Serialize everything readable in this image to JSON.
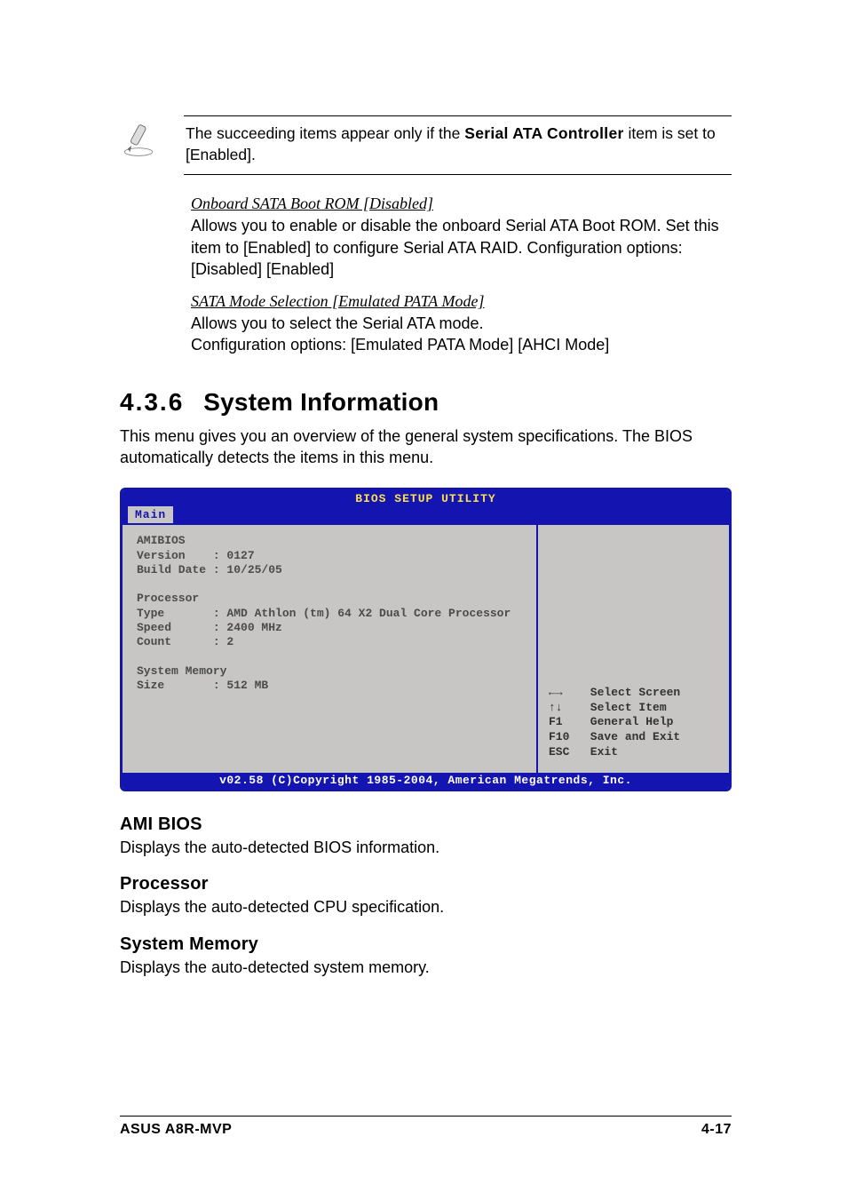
{
  "note": {
    "prefix": "The succeeding items appear only if the ",
    "bold": "Serial ATA Controller",
    "suffix": " item is set to [Enabled]."
  },
  "item1": {
    "title": "Onboard SATA Boot ROM [Disabled]",
    "body": "Allows you to enable or disable the onboard Serial ATA Boot ROM. Set this item to [Enabled] to configure Serial ATA RAID. Configuration options: [Disabled] [Enabled]"
  },
  "item2": {
    "title": "SATA Mode Selection [Emulated PATA Mode]",
    "body": "Allows you to select the Serial ATA mode.\nConfiguration options: [Emulated PATA Mode] [AHCI Mode]"
  },
  "section": {
    "num": "4.3.6",
    "title": "System Information",
    "intro": "This menu gives you an overview of the general system specifications. The BIOS automatically detects the items in this menu."
  },
  "bios": {
    "title": "BIOS SETUP UTILITY",
    "tab": "Main",
    "left": "AMIBIOS\nVersion    : 0127\nBuild Date : 10/25/05\n\nProcessor\nType       : AMD Athlon (tm) 64 X2 Dual Core Processor\nSpeed      : 2400 MHz\nCount      : 2\n\nSystem Memory\nSize       : 512 MB",
    "help": "←→    Select Screen\n↑↓    Select Item\nF1    General Help\nF10   Save and Exit\nESC   Exit",
    "footer": "v02.58 (C)Copyright 1985-2004, American Megatrends, Inc."
  },
  "sub1": {
    "title": "AMI BIOS",
    "body": "Displays the auto-detected BIOS information."
  },
  "sub2": {
    "title": "Processor",
    "body": "Displays the auto-detected CPU specification."
  },
  "sub3": {
    "title": "System Memory",
    "body": "Displays the auto-detected system memory."
  },
  "footer": {
    "left": "ASUS A8R-MVP",
    "right": "4-17"
  }
}
